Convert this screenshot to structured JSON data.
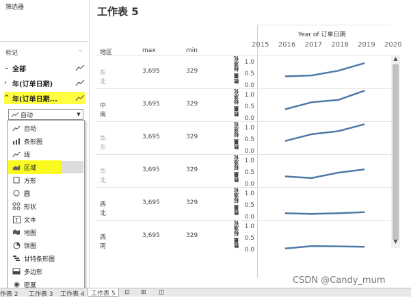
{
  "filters_panel": {
    "title": "筛选器"
  },
  "marks_panel": {
    "title": "标记",
    "rows": [
      {
        "label": "全部"
      },
      {
        "label": "年(订单日期)"
      },
      {
        "label": "年(订单日期..."
      }
    ],
    "mark_type": "自动",
    "menu_items": [
      {
        "label": "自动",
        "icon": "auto-icon"
      },
      {
        "label": "条形图",
        "icon": "bar-icon"
      },
      {
        "label": "线",
        "icon": "line-icon"
      },
      {
        "label": "区域",
        "icon": "area-icon"
      },
      {
        "label": "方形",
        "icon": "square-icon"
      },
      {
        "label": "圆",
        "icon": "circle-icon"
      },
      {
        "label": "形状",
        "icon": "shape-icon"
      },
      {
        "label": "文本",
        "icon": "text-icon"
      },
      {
        "label": "地图",
        "icon": "map-icon"
      },
      {
        "label": "饼图",
        "icon": "pie-icon"
      },
      {
        "label": "甘特条形图",
        "icon": "gantt-icon"
      },
      {
        "label": "多边形",
        "icon": "polygon-icon"
      },
      {
        "label": "密度",
        "icon": "density-icon"
      }
    ],
    "selected": "区域"
  },
  "sheet": {
    "title": "工作表 5",
    "columns": {
      "region": "地区",
      "max": "max",
      "min": "min"
    },
    "x_axis_title": "Year of 订单日期",
    "year_ticks": [
      "2015",
      "2016",
      "2017",
      "2018",
      "2019",
      "2020"
    ],
    "y_axis_label": "数量 标准化",
    "y_ticks": [
      "1.0",
      "0.5",
      "0.0"
    ],
    "line_color": "#4e79a7"
  },
  "chart_data": {
    "type": "line",
    "x": [
      2016,
      2017,
      2018,
      2019
    ],
    "xlim": [
      2015,
      2020
    ],
    "ylim": [
      0,
      1.0
    ],
    "rows": [
      {
        "region": "东北",
        "max": "3,695",
        "min": "329",
        "muted": true,
        "values": [
          0.28,
          0.32,
          0.52,
          0.85
        ]
      },
      {
        "region": "中南",
        "max": "3,695",
        "min": "329",
        "muted": false,
        "values": [
          0.28,
          0.58,
          0.68,
          1.08
        ]
      },
      {
        "region": "华东",
        "max": "3,695",
        "min": "329",
        "muted": true,
        "values": [
          0.33,
          0.62,
          0.75,
          1.05
        ]
      },
      {
        "region": "华北",
        "max": "3,695",
        "min": "329",
        "muted": true,
        "values": [
          0.22,
          0.15,
          0.38,
          0.52
        ]
      },
      {
        "region": "西北",
        "max": "3,695",
        "min": "329",
        "muted": false,
        "values": [
          0.05,
          0.02,
          0.05,
          0.1
        ]
      },
      {
        "region": "西南",
        "max": "3,695",
        "min": "329",
        "muted": false,
        "values": [
          -0.05,
          0.05,
          0.04,
          0.02
        ]
      }
    ]
  },
  "tabs": [
    "作表 2",
    "工作表 3",
    "工作表 4",
    "工作表 5"
  ],
  "watermark": "CSDN @Candy_mum"
}
